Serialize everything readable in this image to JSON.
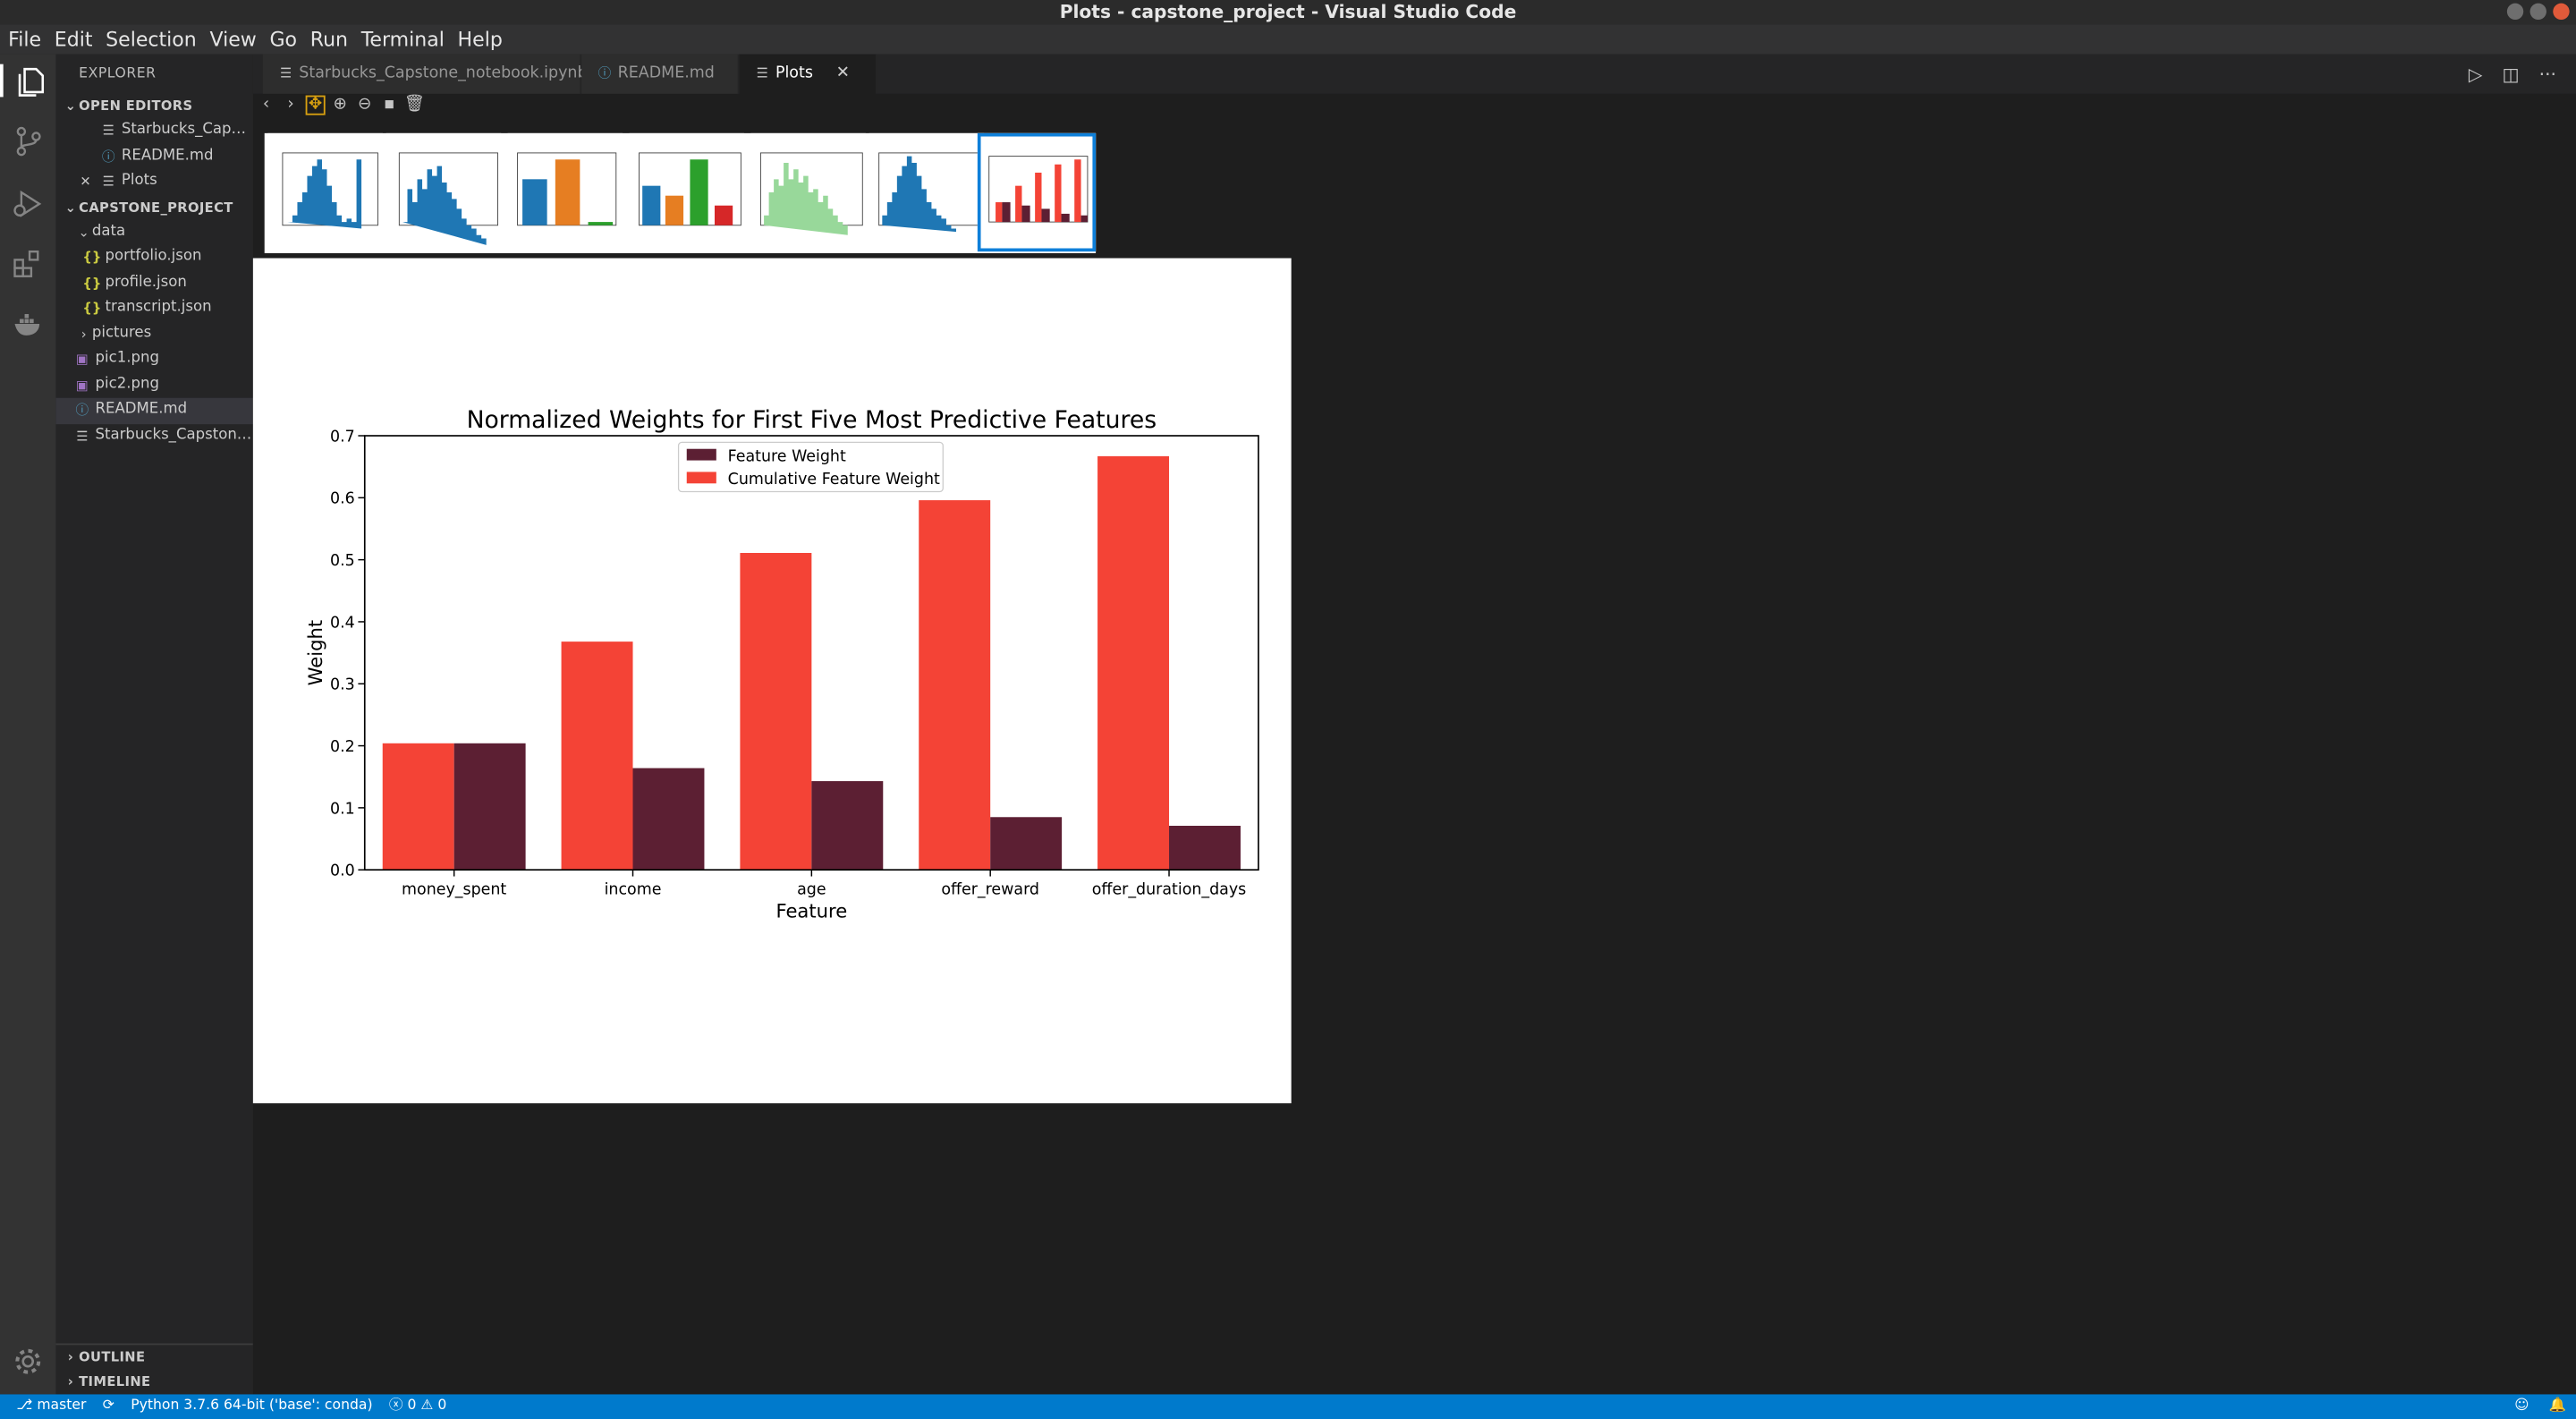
{
  "window": {
    "title": "Plots - capstone_project - Visual Studio Code"
  },
  "menu": [
    "File",
    "Edit",
    "Selection",
    "View",
    "Go",
    "Run",
    "Terminal",
    "Help"
  ],
  "explorer": {
    "title": "EXPLORER",
    "open_editors_label": "OPEN EDITORS",
    "open_editors": [
      {
        "label": "Starbucks_Capst...",
        "icon": "notebook-icon"
      },
      {
        "label": "README.md",
        "icon": "info-icon"
      },
      {
        "label": "Plots",
        "icon": "close-icon"
      }
    ],
    "project_label": "CAPSTONE_PROJECT",
    "tree": {
      "data_folder": "data",
      "data_files": [
        "portfolio.json",
        "profile.json",
        "transcript.json"
      ],
      "pictures_folder": "pictures",
      "files": [
        "pic1.png",
        "pic2.png",
        "README.md",
        "Starbucks_Capstone..."
      ]
    },
    "outline_label": "OUTLINE",
    "timeline_label": "TIMELINE"
  },
  "tabs": [
    "Starbucks_Capstone_notebook.ipynb",
    "README.md",
    "Plots"
  ],
  "active_tab": "Plots",
  "status": {
    "branch": "master",
    "interpreter": "Python 3.7.6 64-bit ('base': conda)",
    "errors": "0",
    "warnings": "0"
  },
  "colors": {
    "accent": "#007acc",
    "feature_weight": "#5c1f33",
    "cumulative_weight": "#f44336"
  },
  "chart_data": {
    "type": "bar",
    "title": "Normalized Weights for First Five Most Predictive Features",
    "xlabel": "Feature",
    "ylabel": "Weight",
    "categories": [
      "money_spent",
      "income",
      "age",
      "offer_reward",
      "offer_duration_days"
    ],
    "series": [
      {
        "name": "Feature Weight",
        "values": [
          0.204,
          0.164,
          0.143,
          0.085,
          0.071
        ]
      },
      {
        "name": "Cumulative Feature Weight",
        "values": [
          0.204,
          0.368,
          0.511,
          0.596,
          0.667
        ]
      }
    ],
    "ylim": [
      0,
      0.7
    ],
    "yticks": [
      "0.0",
      "0.1",
      "0.2",
      "0.3",
      "0.4",
      "0.5",
      "0.6",
      "0.7"
    ],
    "legend": "top-center",
    "grid": false
  }
}
